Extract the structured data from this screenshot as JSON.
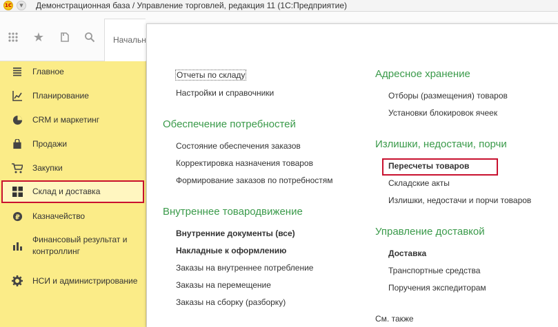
{
  "window": {
    "title": "Демонстрационная база / Управление торговлей, редакция 11  (1С:Предприятие)",
    "logo_text": "1С"
  },
  "toolbar": {
    "home_tab": "Начальная страница"
  },
  "sidebar": {
    "items": [
      {
        "label": "Главное",
        "icon": "menu-lines-icon"
      },
      {
        "label": "Планирование",
        "icon": "planning-chart-icon"
      },
      {
        "label": "CRM и маркетинг",
        "icon": "pie-chart-icon"
      },
      {
        "label": "Продажи",
        "icon": "shopping-bag-icon"
      },
      {
        "label": "Закупки",
        "icon": "shopping-cart-icon"
      },
      {
        "label": "Склад и доставка",
        "icon": "warehouse-grid-icon",
        "selected": true
      },
      {
        "label": "Казначейство",
        "icon": "coin-icon"
      },
      {
        "label": "Финансовый результат и контроллинг",
        "icon": "bar-chart-icon"
      },
      {
        "label": "НСИ и администрирование",
        "icon": "gear-icon"
      }
    ]
  },
  "content": {
    "col1": {
      "top_links": [
        "Отчеты по складу",
        "Настройки и справочники"
      ],
      "group1": {
        "title": "Обеспечение потребностей",
        "links": [
          "Состояние обеспечения заказов",
          "Корректировка назначения товаров",
          "Формирование заказов по потребностям"
        ]
      },
      "group2": {
        "title": "Внутреннее товародвижение",
        "links": [
          "Внутренние документы (все)",
          "Накладные к оформлению",
          "Заказы на внутреннее потребление",
          "Заказы на перемещение",
          "Заказы на сборку (разборку)"
        ]
      }
    },
    "col2": {
      "group1": {
        "title": "Адресное хранение",
        "links": [
          "Отборы (размещения) товаров",
          "Установки блокировок ячеек"
        ]
      },
      "group2": {
        "title": "Излишки, недостачи, порчи",
        "links": [
          "Пересчеты товаров",
          "Складские акты",
          "Излишки, недостачи и порчи товаров"
        ]
      },
      "group3": {
        "title": "Управление доставкой",
        "links": [
          "Доставка",
          "Транспортные средства",
          "Поручения экспедиторам"
        ]
      },
      "see_also": "См. также"
    }
  },
  "colors": {
    "accent_green": "#3a9a4a",
    "sidebar_yellow": "#fbec88",
    "highlight_red": "#c8102e"
  }
}
